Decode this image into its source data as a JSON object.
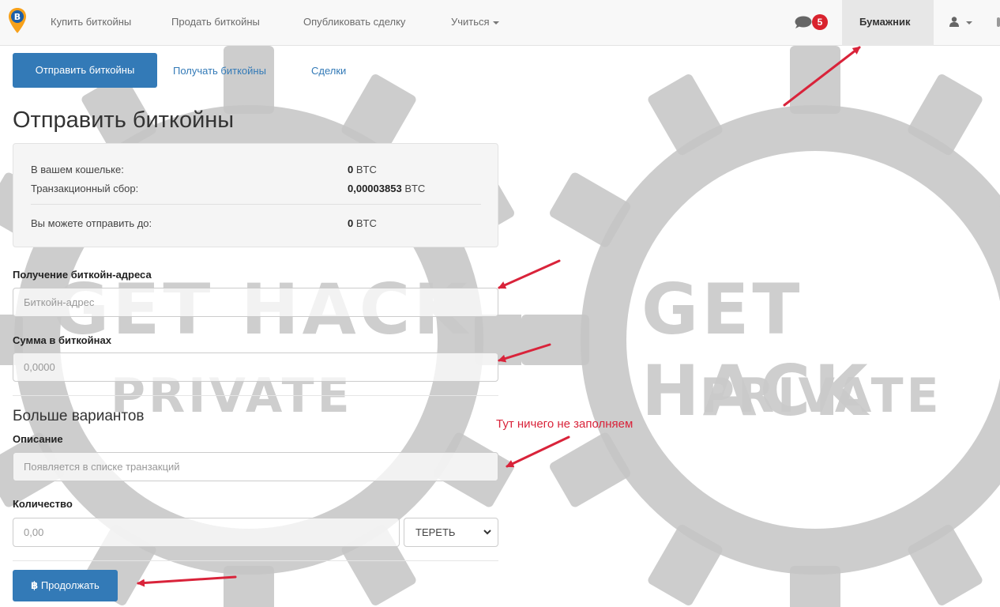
{
  "nav": {
    "items": [
      {
        "label": "Купить биткойны"
      },
      {
        "label": "Продать биткойны"
      },
      {
        "label": "Опубликовать сделку"
      },
      {
        "label": "Учиться"
      }
    ],
    "notifications_count": "5",
    "wallet_label": "Бумажник"
  },
  "tabs": {
    "send": "Отправить биткойны",
    "receive": "Получать биткойны",
    "deals": "Сделки"
  },
  "page_title": "Отправить биткойны",
  "balance": {
    "wallet_label": "В вашем кошельке:",
    "wallet_amount": "0",
    "wallet_unit": "BTC",
    "fee_label": "Транзакционный сбор:",
    "fee_amount": "0,00003853",
    "fee_unit": "BTC",
    "max_label": "Вы можете отправить до:",
    "max_amount": "0",
    "max_unit": "BTC"
  },
  "form": {
    "address_label": "Получение биткойн-адреса",
    "address_placeholder": "Биткойн-адрес",
    "amount_label": "Сумма в биткойнах",
    "amount_placeholder": "0,0000",
    "more_options": "Больше вариантов",
    "description_label": "Описание",
    "description_placeholder": "Появляется в списке транзакций",
    "quantity_label": "Количество",
    "quantity_placeholder": "0,00",
    "currency_selected": "ТЕРЕТЬ",
    "submit_label": "Продолжать",
    "submit_icon": "bitcoin-icon"
  },
  "annotation": {
    "text": "Тут ничего не заполняем",
    "color": "#d9233a"
  },
  "watermark": {
    "line1": "GET HACK",
    "line2": "PRIVATE"
  },
  "colors": {
    "primary": "#337ab7",
    "badge": "#d9232e",
    "arrow": "#d9233a"
  }
}
